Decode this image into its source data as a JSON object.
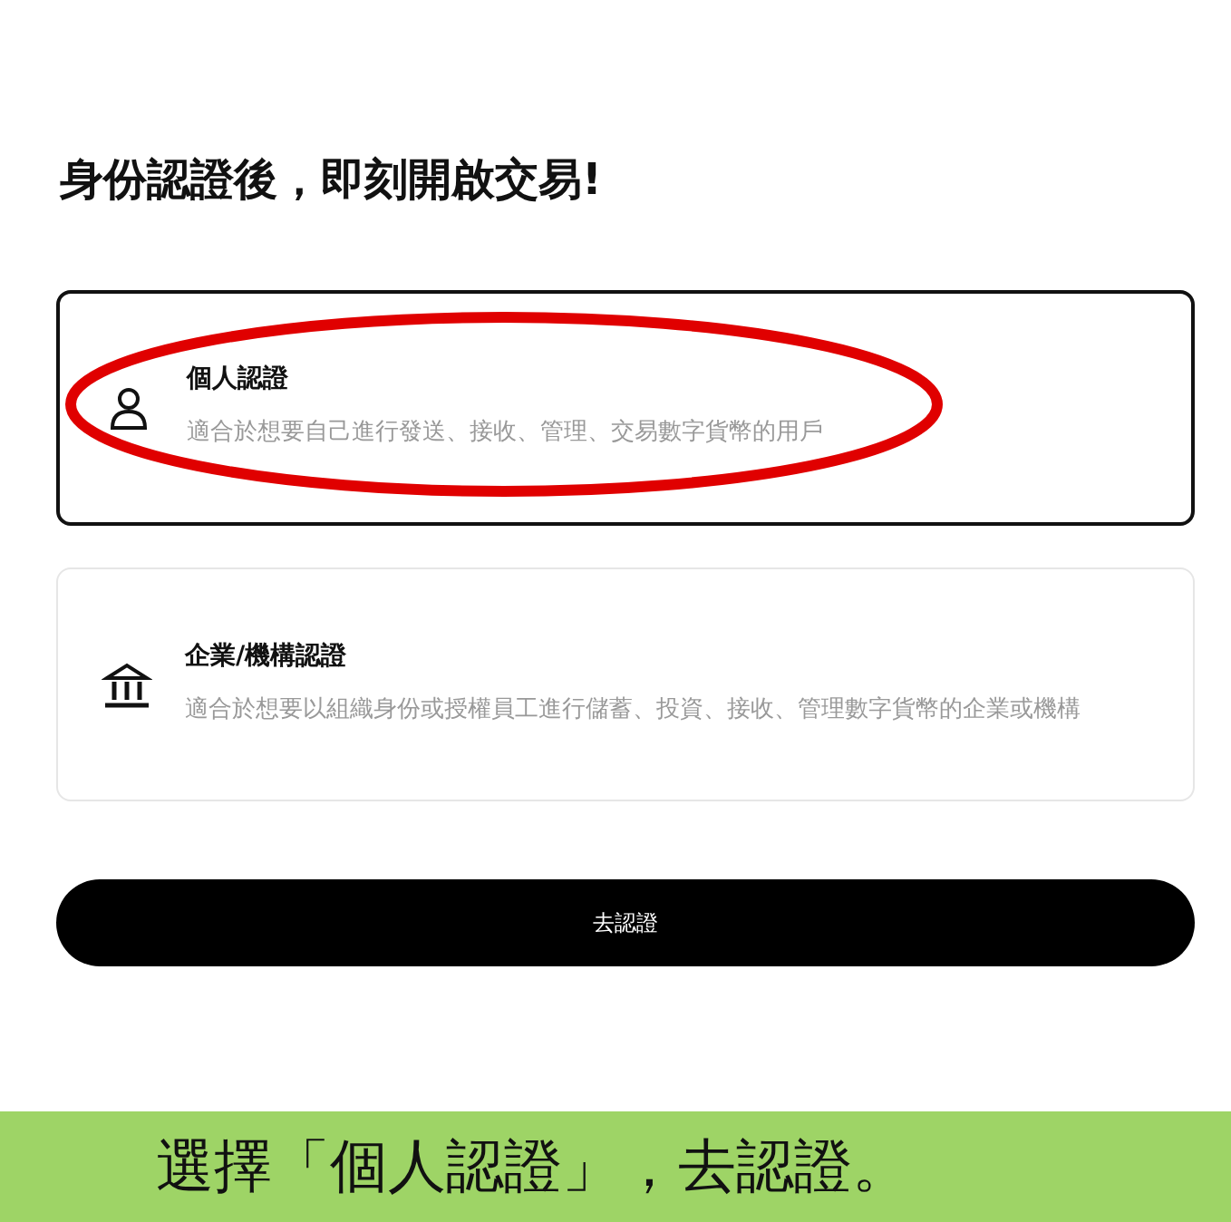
{
  "heading": "身份認證後，即刻開啟交易!",
  "options": [
    {
      "kind": "person",
      "title": "個人認證",
      "description": "適合於想要自己進行發送、接收、管理、交易數字貨幣的用戶",
      "selected": true,
      "circled": true
    },
    {
      "kind": "institution",
      "title": "企業/機構認證",
      "description": "適合於想要以組織身份或授權員工進行儲蓄、投資、接收、管理數字貨幣的企業或機構",
      "selected": false,
      "circled": false
    }
  ],
  "button": "去認證",
  "caption": "選擇「個人認證」，去認證。"
}
